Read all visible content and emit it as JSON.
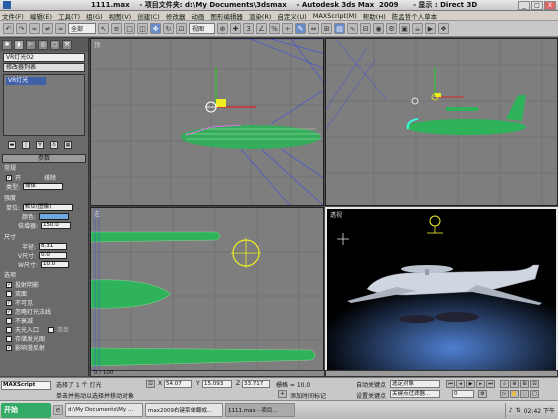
{
  "window": {
    "title": "1111.max    - 项目文件夹: d:\\My Documents\\3dsmax    - Autodesk 3ds Max  2009      - 显示 : Direct 3D",
    "min_label": "_",
    "max_label": "□",
    "close_label": "X"
  },
  "menu": [
    "文件(F)",
    "编辑(E)",
    "工具(T)",
    "组(G)",
    "视图(V)",
    "创建(C)",
    "修改器",
    "动画",
    "图形编辑器",
    "渲染(R)",
    "自定义(U)",
    "MAXScript(M)",
    "帮助(H)",
    "陈孟哲个人草本"
  ],
  "toolbar": {
    "selection_filter": "全部",
    "reference_coord": "视图"
  },
  "command_panel": {
    "name_field": "VR灯光02",
    "modifier_list": "修改器列表",
    "stack_item": "VR灯光",
    "rollout_params": "参数",
    "general_label": "常规",
    "on_label": "开",
    "exclude_label": "排除",
    "type_label": "类型:",
    "type_value": "球体",
    "intensity_label": "强度",
    "units_label": "单位:",
    "units_value": "默认(图像)",
    "color_label": "颜色:",
    "multiplier_label": "倍增器:",
    "multiplier_value": "150.0",
    "size_label": "尺寸",
    "radius_label": "半径:",
    "radius_value": "8.31",
    "v_size_label": "V尺寸:",
    "v_size_value": "0.0",
    "w_size_label": "W尺寸:",
    "w_size_value": "10.0",
    "options_label": "选项",
    "options": [
      "投射阴影",
      "双面",
      "不可见",
      "忽略灯光法线",
      "不衰减",
      "天光入口",
      "存储发光图",
      "影响漫反射"
    ],
    "simple_label": "简单"
  },
  "viewports": {
    "top_left": {
      "label": "顶"
    },
    "top_right": {
      "label": ""
    },
    "bottom_left": {
      "label": "左"
    },
    "bottom_right": {
      "label": "透视"
    }
  },
  "timeline": {
    "frame": "0 / 100"
  },
  "status": {
    "selected": "选择了 1 个 灯光",
    "prompt": "单击并拖动以选择并移动对象",
    "x_value": "54.07",
    "y_value": "15.093",
    "z_value": "33.717",
    "grid": "栅格 = 10.0",
    "add_time_tag": "添加时间标记",
    "auto_key": "自动关键点",
    "selected_obj": "选定对象",
    "set_key": "设置关键点",
    "key_filters": "关键点过滤器...",
    "frame_value": "0"
  },
  "taskbar": {
    "start": "开始",
    "tasks": [
      "d:\\My Documents\\My ...",
      "max2009右键菜单翻成...",
      "1111.max - 项目..."
    ],
    "clock": "02:42 下午"
  },
  "colors": {
    "accent": "#4060a8",
    "light_swatch": "#6fa7e0"
  }
}
